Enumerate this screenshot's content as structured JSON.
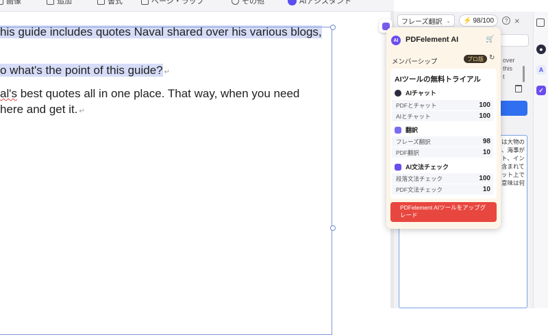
{
  "toolbar": {
    "items": [
      {
        "label": "画像"
      },
      {
        "label": "追加"
      },
      {
        "label": "書式"
      },
      {
        "label": "ページ・ラップ"
      },
      {
        "label": "その他"
      },
      {
        "label": "AIアシスタント"
      }
    ]
  },
  "document": {
    "lines": [
      {
        "text": "his guide includes quotes Naval shared over his various blogs,",
        "highlighted": true
      },
      {
        "text": "o what's the point of this guide?",
        "highlighted": true
      },
      {
        "text_a": "al's",
        "text_b": " best quotes all in one place. That way, when you need",
        "highlighted": false
      },
      {
        "text": "here and get it.",
        "highlighted": false
      }
    ],
    "para_mark": "↵"
  },
  "ai_header": {
    "mode_select": "フレーズ翻訳",
    "credits": "98/100",
    "help_icon": "?",
    "close_icon": "×"
  },
  "background_panel": {
    "snippet_lines": [
      "over",
      "this",
      "t"
    ],
    "translated_lines": [
      "は大物の",
      "、海事が",
      "ト、イン",
      "含まれて",
      "ット上で",
      "意味は何"
    ]
  },
  "popup": {
    "logo": "AI",
    "title": "PDFelement AI",
    "membership_label": "メンバーシップ",
    "membership_badge": "プロ版",
    "card_title": "AIツールの無料トライアル",
    "sections": [
      {
        "title": "AIチャット",
        "icon": "chat-icon",
        "rows": [
          {
            "label": "PDFとチャット",
            "value": "100"
          },
          {
            "label": "AIとチャット",
            "value": "100"
          }
        ]
      },
      {
        "title": "翻訳",
        "icon": "translate-icon",
        "rows": [
          {
            "label": "フレーズ翻訳",
            "value": "98"
          },
          {
            "label": "PDF翻訳",
            "value": "10"
          }
        ]
      },
      {
        "title": "AI文法チェック",
        "icon": "grammar-check-icon",
        "rows": [
          {
            "label": "段落文法チェック",
            "value": "100"
          },
          {
            "label": "PDF文法チェック",
            "value": "10"
          }
        ]
      }
    ],
    "upgrade_label": "PDFelement AIツールをアップグレード"
  },
  "colors": {
    "accent": "#6a4cf0",
    "upgrade": "#e8473f",
    "highlight": "#d6dcf7",
    "selection": "#7a9ad8"
  }
}
